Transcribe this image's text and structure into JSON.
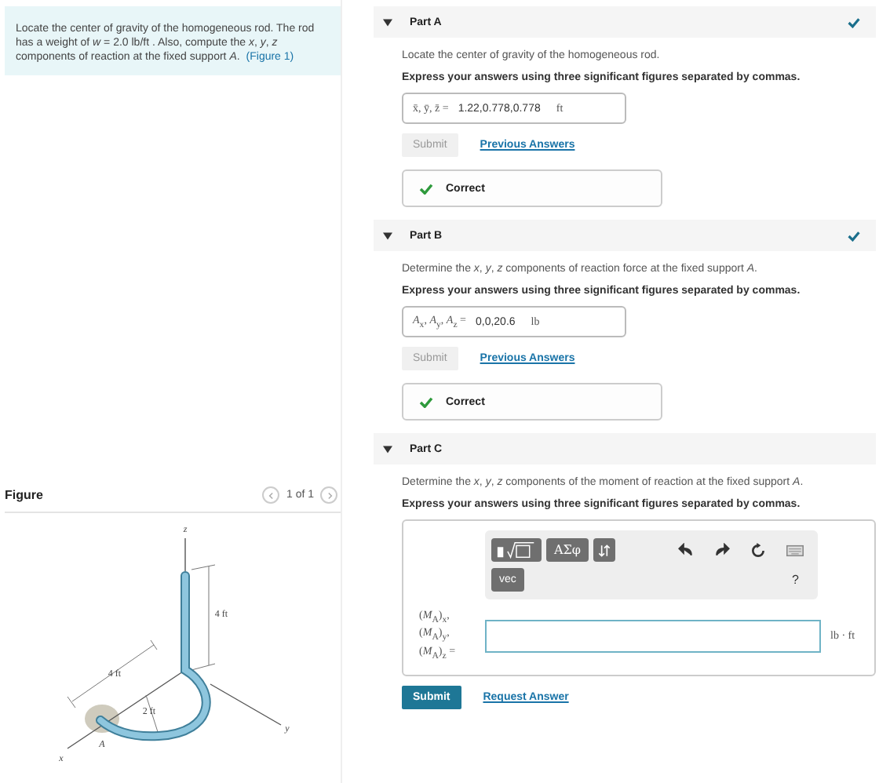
{
  "intro": {
    "text": "Locate the center of gravity of the homogeneous rod. The rod has a weight of *w* = 2.0 lb/ft . Also, compute the *x*, *y*, *z* components of reaction at the fixed support *A*.",
    "link": "(Figure 1)"
  },
  "figure": {
    "title": "Figure",
    "pager": "1 of 1",
    "labels": [
      {
        "kind": "axis",
        "text": "z"
      },
      {
        "kind": "dimension",
        "text": "4 ft"
      },
      {
        "kind": "dimension",
        "text": "4 ft"
      },
      {
        "kind": "dimension",
        "text": "2 ft"
      },
      {
        "kind": "axis",
        "text": "x"
      },
      {
        "kind": "axis",
        "text": "y"
      },
      {
        "kind": "point",
        "text": "A"
      }
    ]
  },
  "parts": [
    {
      "kind": "answered",
      "title": "Part A",
      "expanded": true,
      "complete": true,
      "prompt": "Locate the center of gravity of the homogeneous rod.",
      "instruction": "Express your answers using three significant figures separated by commas.",
      "answer": {
        "label": "x̄, ȳ, z̄ =",
        "value": "1.22,0.778,0.778",
        "unit": "ft"
      },
      "submit": {
        "label": "Submit",
        "disabled": true
      },
      "link": "Previous Answers",
      "feedback": "Correct"
    },
    {
      "kind": "answered",
      "title": "Part B",
      "expanded": true,
      "complete": true,
      "prompt": "Determine the *x*, *y*, *z* components of reaction force at the fixed support *A*.",
      "instruction": "Express your answers using three significant figures separated by commas.",
      "answer": {
        "label": "*A*$_{x}$, *A*$_{y}$, *A*$_{z}$ =",
        "value": "0,0,20.6",
        "unit": "lb"
      },
      "submit": {
        "label": "Submit",
        "disabled": true
      },
      "link": "Previous Answers",
      "feedback": "Correct"
    },
    {
      "kind": "editor",
      "title": "Part C",
      "expanded": true,
      "complete": false,
      "prompt": "Determine the *x*, *y*, *z* components of the moment of reaction at the fixed support *A*.",
      "instruction": "Express your answers using three significant figures separated by commas.",
      "toolbar": {
        "tools": [
          {
            "kind": "templates"
          },
          {
            "kind": "text",
            "label": "ΑΣφ"
          },
          {
            "kind": "arrows"
          }
        ],
        "actions": [
          {
            "kind": "undo"
          },
          {
            "kind": "redo"
          },
          {
            "kind": "reset"
          },
          {
            "kind": "keyboard"
          }
        ],
        "extra": "vec",
        "help": "?"
      },
      "answer": {
        "labels": [
          "(*M*$_{A}$)$_{x}$,",
          "(*M*$_{A}$)$_{y}$,",
          "(*M*$_{A}$)$_{z}$ ="
        ],
        "unit": "lb · ft"
      },
      "submit": {
        "label": "Submit",
        "disabled": false
      },
      "link": "Request Answer"
    }
  ]
}
